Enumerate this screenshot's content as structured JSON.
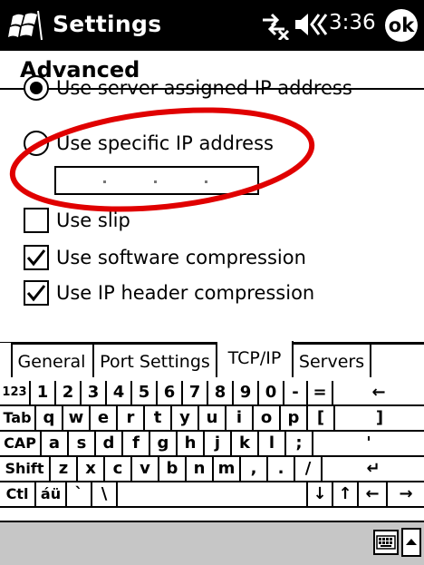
{
  "titlebar": {
    "title": "Settings",
    "time": "3:36",
    "ok_label": "ok"
  },
  "header": {
    "title": "Advanced"
  },
  "options": {
    "server_ip_label": "Use server-assigned IP address",
    "server_ip_selected": true,
    "specific_ip_label": "Use specific IP address",
    "specific_ip_selected": false,
    "ip_value": "",
    "use_slip_label": "Use slip",
    "use_slip_checked": false,
    "software_compression_label": "Use software compression",
    "software_compression_checked": true,
    "ip_header_compression_label": "Use IP header compression",
    "ip_header_compression_checked": true
  },
  "annotation": {
    "ellipse_color": "#e00000"
  },
  "tabs": [
    {
      "label": "General"
    },
    {
      "label": "Port Settings"
    },
    {
      "label": "TCP/IP",
      "selected": true
    },
    {
      "label": "Servers"
    }
  ],
  "keyboard": {
    "row1": [
      "123",
      "1",
      "2",
      "3",
      "4",
      "5",
      "6",
      "7",
      "8",
      "9",
      "0",
      "-",
      "=",
      "←"
    ],
    "row2": [
      "Tab",
      "q",
      "w",
      "e",
      "r",
      "t",
      "y",
      "u",
      "i",
      "o",
      "p",
      "[",
      "]"
    ],
    "row3": [
      "CAP",
      "a",
      "s",
      "d",
      "f",
      "g",
      "h",
      "j",
      "k",
      "l",
      ";",
      "'"
    ],
    "row4": [
      "Shift",
      "z",
      "x",
      "c",
      "v",
      "b",
      "n",
      "m",
      ",",
      ".",
      "/",
      "↵"
    ],
    "row5": [
      "Ctl",
      "áü",
      "`",
      "\\",
      "",
      "↓",
      "↑",
      "←",
      "→"
    ]
  },
  "colors": {
    "titlebar_bg": "#000000",
    "bottombar_bg": "#c6c6c6"
  }
}
